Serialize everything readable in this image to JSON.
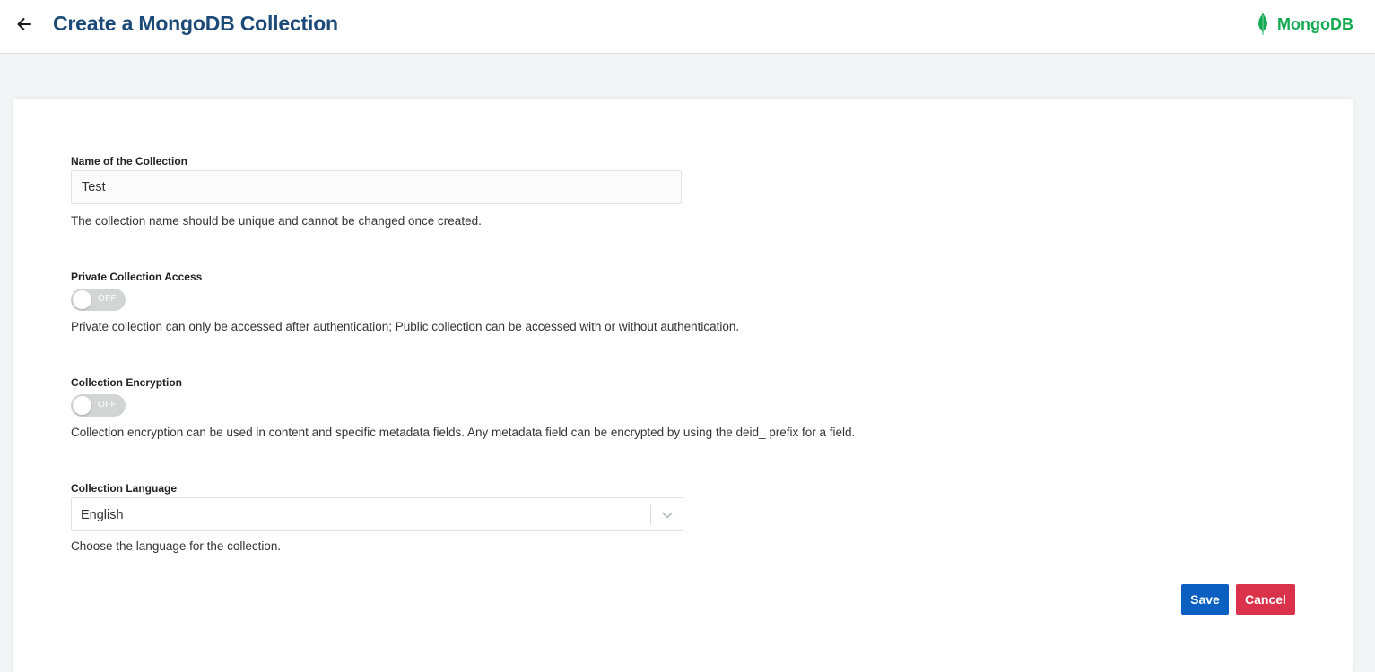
{
  "header": {
    "title": "Create a MongoDB Collection",
    "back_icon": "arrow-left-icon",
    "brand_name": "MongoDB",
    "brand_icon": "mongodb-leaf-icon",
    "brand_color": "#13aa52",
    "title_color": "#1b4a78"
  },
  "form": {
    "name": {
      "label": "Name of the Collection",
      "value": "Test",
      "help": "The collection name should be unique and cannot be changed once created."
    },
    "private_access": {
      "label": "Private Collection Access",
      "state": "OFF",
      "help": "Private collection can only be accessed after authentication; Public collection can be accessed with or without authentication."
    },
    "encryption": {
      "label": "Collection Encryption",
      "state": "OFF",
      "help": "Collection encryption can be used in content and specific metadata fields. Any metadata field can be encrypted by using the deid_ prefix for a field."
    },
    "language": {
      "label": "Collection Language",
      "selected": "English",
      "dropdown_icon": "chevron-down-icon",
      "help": "Choose the language for the collection."
    }
  },
  "actions": {
    "save_label": "Save",
    "save_color": "#0a5fc0",
    "cancel_label": "Cancel",
    "cancel_color": "#d9324a"
  }
}
